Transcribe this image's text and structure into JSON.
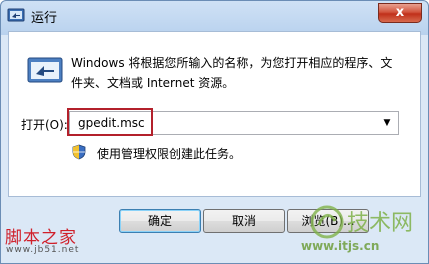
{
  "window": {
    "title": "运行",
    "close_glyph": "x"
  },
  "dialog": {
    "description": "Windows 将根据您所输入的名称，为您打开相应的程序、文件夹、文档或 Internet 资源。",
    "open_label": "打开(O):",
    "input_value": "gpedit.msc",
    "dropdown_glyph": "▼",
    "admin_note": "使用管理权限创建此任务。"
  },
  "buttons": {
    "ok": "确定",
    "cancel": "取消",
    "browse": "浏览(B)..."
  },
  "watermark": {
    "left_title": "脚本之家",
    "left_url": "www.jb51.net",
    "right_logo_text": "技术网",
    "right_url": "www.itjs.cn"
  },
  "colors": {
    "highlight_box": "#b3202b",
    "watermark_red": "#d01f2a",
    "watermark_green": "#6f9f3e"
  }
}
